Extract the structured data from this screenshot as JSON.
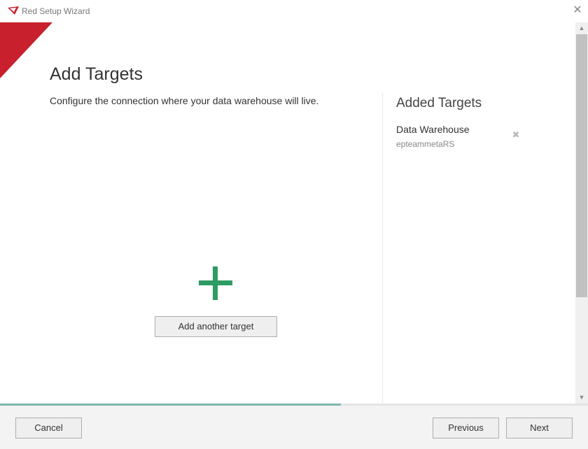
{
  "window": {
    "title": "Red Setup Wizard",
    "icon": "red-logo-icon",
    "close_icon": "close-icon"
  },
  "colors": {
    "brand_red": "#c8202c",
    "plus_green": "#2e9b63",
    "progress": "#7fb5b0"
  },
  "main": {
    "title": "Add Targets",
    "subtitle": "Configure the connection where your data warehouse will live.",
    "add_button_label": "Add another target",
    "add_icon": "plus-icon"
  },
  "sidebar": {
    "title": "Added Targets",
    "targets": [
      {
        "name": "Data Warehouse",
        "detail": "epteammetaRS",
        "remove_icon": "remove-icon"
      }
    ]
  },
  "progress": {
    "fraction": 0.58
  },
  "footer": {
    "cancel_label": "Cancel",
    "previous_label": "Previous",
    "next_label": "Next"
  }
}
